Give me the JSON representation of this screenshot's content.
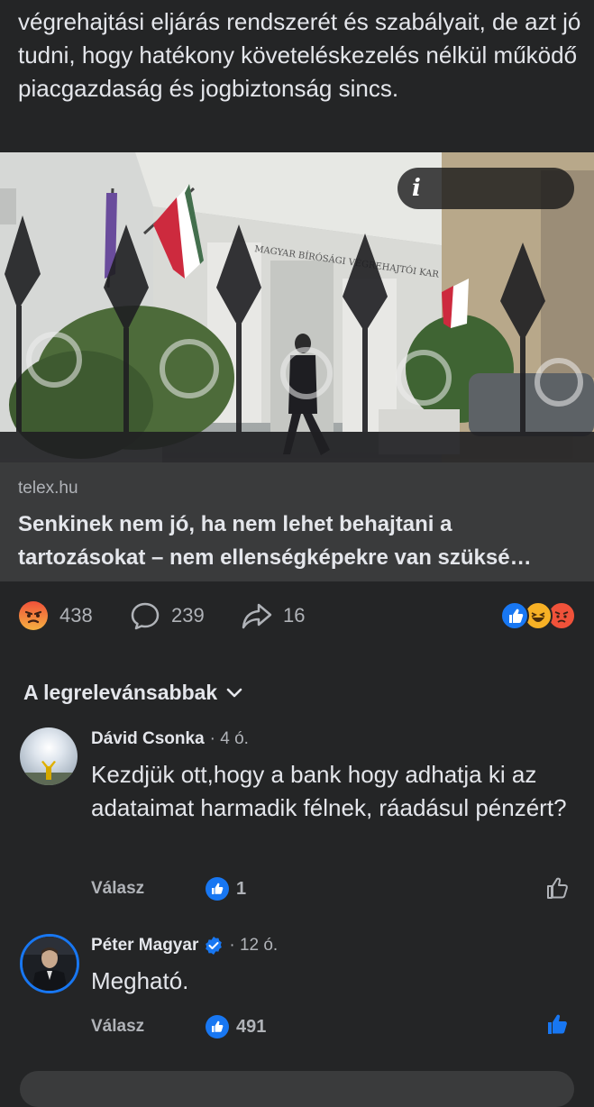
{
  "post": {
    "text": "végrehajtási eljárás rendszerét és szabályait, de azt jó tudni, hogy hatékony követeléskezelés nélkül működő piacgazdaság és jogbiztonság sincs."
  },
  "link": {
    "info_icon": "info-icon",
    "domain": "telex.hu",
    "title_line1": "Senkinek nem jó, ha nem lehet behajtani a",
    "title_line2": "tartozásokat – nem ellenségképekre van szüksé…",
    "building_sign": "MAGYAR BÍRÓSÁGI VÉGREHAJTÓI KAR"
  },
  "actions": {
    "reactions_count": "438",
    "comments_count": "239",
    "shares_count": "16"
  },
  "sort": {
    "label": "A legrelevánsabbak"
  },
  "comments": [
    {
      "name": "Dávid Csonka",
      "time": "· 4 ó.",
      "body": "Kezdjük ott,hogy a bank hogy adhatja ki az adataimat harmadik félnek, ráadásul pénzért?",
      "reply_label": "Válasz",
      "likes": "1",
      "verified": false
    },
    {
      "name": "Péter Magyar",
      "time": "· 12 ó.",
      "body": "Megható.",
      "reply_label": "Válasz",
      "likes": "491",
      "verified": true
    }
  ],
  "colors": {
    "background": "#242526",
    "link_meta_bg": "#3a3b3c",
    "like_blue": "#1877f2",
    "angry": "#f0523a",
    "haha": "#f7b125"
  }
}
